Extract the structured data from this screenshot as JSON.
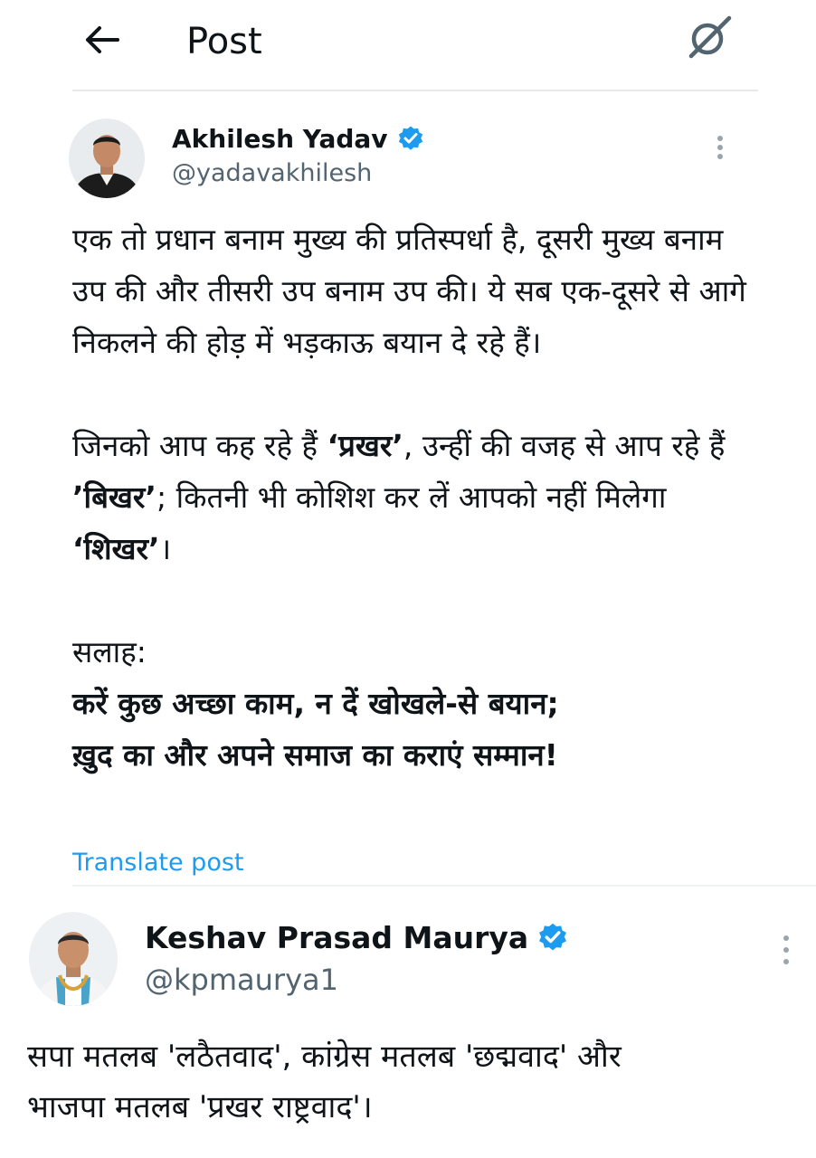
{
  "header": {
    "title": "Post",
    "back_icon": "arrow-left-icon",
    "grok_icon": "grok-icon"
  },
  "post1": {
    "author": {
      "name": "Akhilesh Yadav",
      "handle": "@yadavakhilesh",
      "verified": true
    },
    "paragraph1": "एक तो प्रधान बनाम मुख्य की प्रतिस्पर्धा है, दूसरी मुख्य बनाम उप की और तीसरी उप बनाम उप की। ये सब एक-दूसरे से आगे निकलने की होड़ में भड़काऊ बयान दे रहे हैं।",
    "paragraph2": {
      "t1": "जिनको आप कह रहे हैं ",
      "b1": "‘प्रखर’",
      "t2": ", उन्हीं की वजह से आप रहे हैं ",
      "b2": "’बिखर’",
      "t3": "; कितनी भी कोशिश कर लें आपको नहीं मिलेगा ",
      "b3": "‘शिखर’",
      "t4": "।"
    },
    "advice_label": "सलाह:",
    "advice_line1": "करें कुछ अच्छा काम, न दें खोखले-से बयान;",
    "advice_line2": "ख़ुद का और अपने समाज का कराएं सम्मान!",
    "translate_label": "Translate post"
  },
  "post2": {
    "author": {
      "name": "Keshav Prasad Maurya",
      "handle": "@kpmaurya1",
      "verified": true
    },
    "line1": "सपा मतलब 'लठैतवाद', कांग्रेस मतलब 'छद्मवाद' और",
    "line2": "भाजपा मतलब 'प्रखर राष्ट्रवाद'।"
  },
  "colors": {
    "verified_blue": "#1d9bf0",
    "link_blue": "#1d9bf0",
    "secondary_text": "#536471"
  }
}
